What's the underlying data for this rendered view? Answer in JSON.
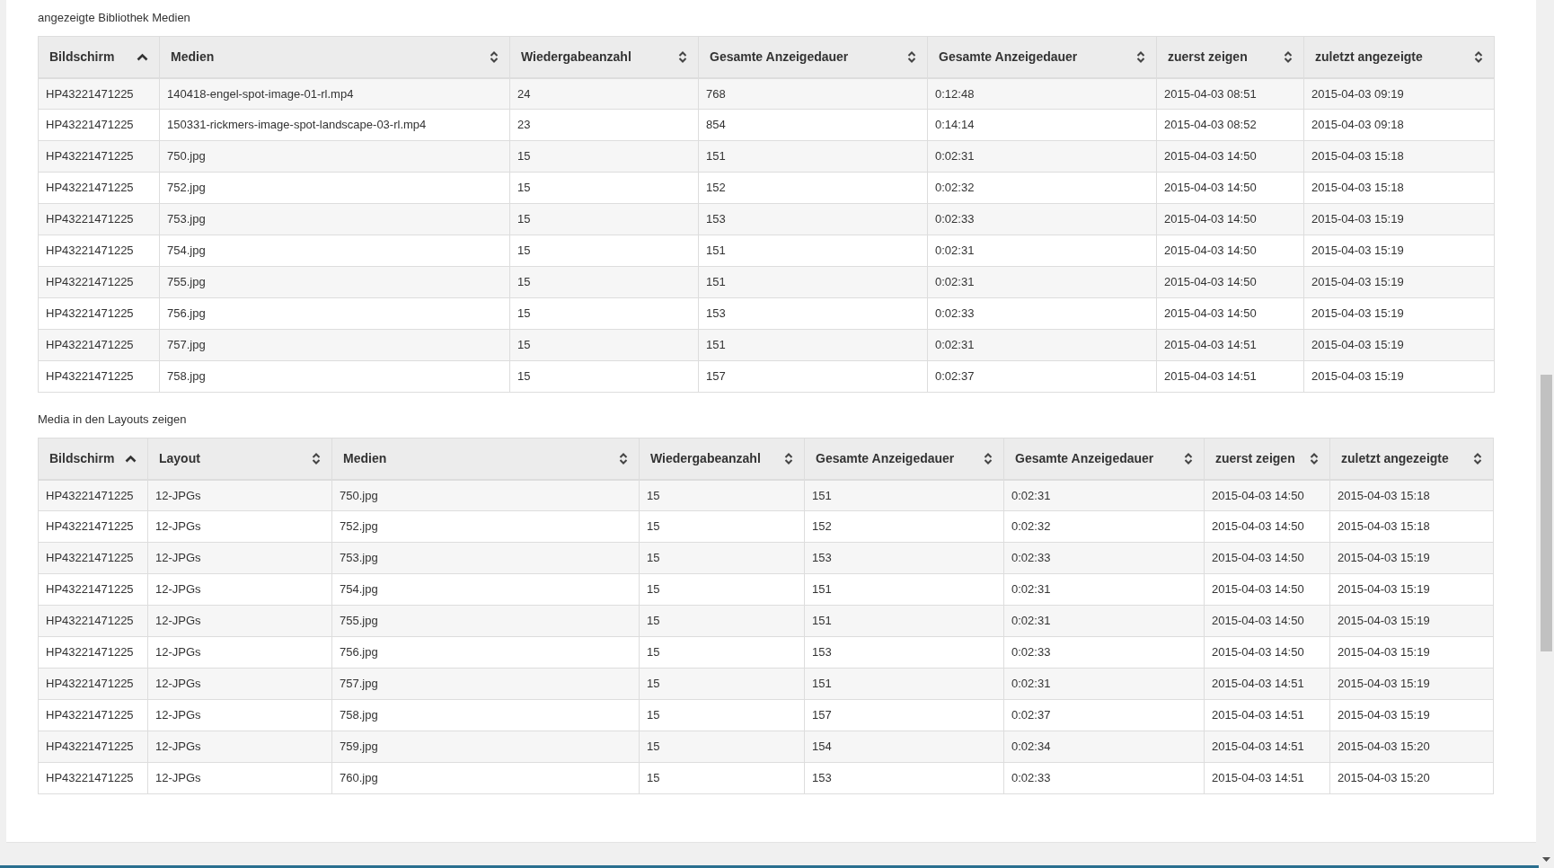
{
  "sections": [
    {
      "title": "angezeigte Bibliothek Medien",
      "columns": [
        {
          "label": "Bildschirm",
          "sorted_ascending": true
        },
        {
          "label": "Medien",
          "sorted_ascending": false
        },
        {
          "label": "Wiedergabeanzahl",
          "sorted_ascending": false
        },
        {
          "label": "Gesamte Anzeigedauer",
          "sorted_ascending": false
        },
        {
          "label": "Gesamte Anzeigedauer",
          "sorted_ascending": false
        },
        {
          "label": "zuerst zeigen",
          "sorted_ascending": false
        },
        {
          "label": "zuletzt angezeigte",
          "sorted_ascending": false
        }
      ],
      "rows": [
        [
          "HP43221471225",
          "140418-engel-spot-image-01-rl.mp4",
          "24",
          "768",
          "0:12:48",
          "2015-04-03 08:51",
          "2015-04-03 09:19"
        ],
        [
          "HP43221471225",
          "150331-rickmers-image-spot-landscape-03-rl.mp4",
          "23",
          "854",
          "0:14:14",
          "2015-04-03 08:52",
          "2015-04-03 09:18"
        ],
        [
          "HP43221471225",
          "750.jpg",
          "15",
          "151",
          "0:02:31",
          "2015-04-03 14:50",
          "2015-04-03 15:18"
        ],
        [
          "HP43221471225",
          "752.jpg",
          "15",
          "152",
          "0:02:32",
          "2015-04-03 14:50",
          "2015-04-03 15:18"
        ],
        [
          "HP43221471225",
          "753.jpg",
          "15",
          "153",
          "0:02:33",
          "2015-04-03 14:50",
          "2015-04-03 15:19"
        ],
        [
          "HP43221471225",
          "754.jpg",
          "15",
          "151",
          "0:02:31",
          "2015-04-03 14:50",
          "2015-04-03 15:19"
        ],
        [
          "HP43221471225",
          "755.jpg",
          "15",
          "151",
          "0:02:31",
          "2015-04-03 14:50",
          "2015-04-03 15:19"
        ],
        [
          "HP43221471225",
          "756.jpg",
          "15",
          "153",
          "0:02:33",
          "2015-04-03 14:50",
          "2015-04-03 15:19"
        ],
        [
          "HP43221471225",
          "757.jpg",
          "15",
          "151",
          "0:02:31",
          "2015-04-03 14:51",
          "2015-04-03 15:19"
        ],
        [
          "HP43221471225",
          "758.jpg",
          "15",
          "157",
          "0:02:37",
          "2015-04-03 14:51",
          "2015-04-03 15:19"
        ]
      ]
    },
    {
      "title": "Media in den Layouts zeigen",
      "columns": [
        {
          "label": "Bildschirm",
          "sorted_ascending": true
        },
        {
          "label": "Layout",
          "sorted_ascending": false
        },
        {
          "label": "Medien",
          "sorted_ascending": false
        },
        {
          "label": "Wiedergabeanzahl",
          "sorted_ascending": false
        },
        {
          "label": "Gesamte Anzeigedauer",
          "sorted_ascending": false
        },
        {
          "label": "Gesamte Anzeigedauer",
          "sorted_ascending": false
        },
        {
          "label": "zuerst zeigen",
          "sorted_ascending": false
        },
        {
          "label": "zuletzt angezeigte",
          "sorted_ascending": false
        }
      ],
      "rows": [
        [
          "HP43221471225",
          "12-JPGs",
          "750.jpg",
          "15",
          "151",
          "0:02:31",
          "2015-04-03 14:50",
          "2015-04-03 15:18"
        ],
        [
          "HP43221471225",
          "12-JPGs",
          "752.jpg",
          "15",
          "152",
          "0:02:32",
          "2015-04-03 14:50",
          "2015-04-03 15:18"
        ],
        [
          "HP43221471225",
          "12-JPGs",
          "753.jpg",
          "15",
          "153",
          "0:02:33",
          "2015-04-03 14:50",
          "2015-04-03 15:19"
        ],
        [
          "HP43221471225",
          "12-JPGs",
          "754.jpg",
          "15",
          "151",
          "0:02:31",
          "2015-04-03 14:50",
          "2015-04-03 15:19"
        ],
        [
          "HP43221471225",
          "12-JPGs",
          "755.jpg",
          "15",
          "151",
          "0:02:31",
          "2015-04-03 14:50",
          "2015-04-03 15:19"
        ],
        [
          "HP43221471225",
          "12-JPGs",
          "756.jpg",
          "15",
          "153",
          "0:02:33",
          "2015-04-03 14:50",
          "2015-04-03 15:19"
        ],
        [
          "HP43221471225",
          "12-JPGs",
          "757.jpg",
          "15",
          "151",
          "0:02:31",
          "2015-04-03 14:51",
          "2015-04-03 15:19"
        ],
        [
          "HP43221471225",
          "12-JPGs",
          "758.jpg",
          "15",
          "157",
          "0:02:37",
          "2015-04-03 14:51",
          "2015-04-03 15:19"
        ],
        [
          "HP43221471225",
          "12-JPGs",
          "759.jpg",
          "15",
          "154",
          "0:02:34",
          "2015-04-03 14:51",
          "2015-04-03 15:20"
        ],
        [
          "HP43221471225",
          "12-JPGs",
          "760.jpg",
          "15",
          "153",
          "0:02:33",
          "2015-04-03 14:51",
          "2015-04-03 15:20"
        ]
      ]
    }
  ]
}
